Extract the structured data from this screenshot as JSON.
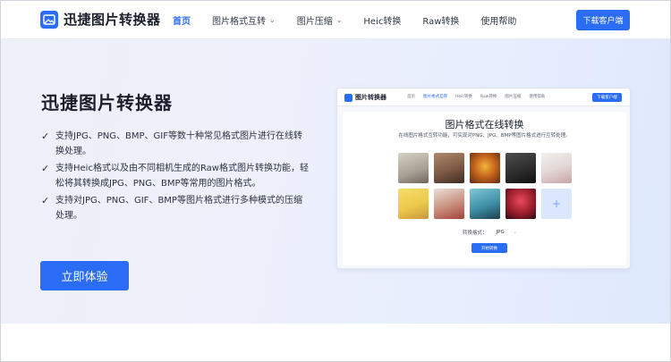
{
  "nav": {
    "logo_text": "迅捷图片转换器",
    "menu": [
      {
        "label": "首页",
        "has_dropdown": false,
        "active": true
      },
      {
        "label": "图片格式互转",
        "has_dropdown": true,
        "active": false
      },
      {
        "label": "图片压缩",
        "has_dropdown": true,
        "active": false
      },
      {
        "label": "Heic转换",
        "has_dropdown": false,
        "active": false
      },
      {
        "label": "Raw转换",
        "has_dropdown": false,
        "active": false
      },
      {
        "label": "使用帮助",
        "has_dropdown": false,
        "active": false
      }
    ],
    "download_btn": "下载客户端"
  },
  "hero": {
    "title": "迅捷图片转换器",
    "features": [
      "支持JPG、PNG、BMP、GIF等数十种常见格式图片进行在线转换处理。",
      "支持Heic格式以及由不同相机生成的Raw格式图片转换功能，轻松将其转换成JPG、PNG、BMP等常用的图片格式。",
      "支持对JPG、PNG、GIF、BMP等图片格式进行多种模式的压缩处理。"
    ],
    "cta_label": "立即体验"
  },
  "preview": {
    "logo_text": "图片转换器",
    "menu": [
      "首页",
      "图片格式互转",
      "Heic转换",
      "Raw转换",
      "图片压缩",
      "使用帮助"
    ],
    "download_btn": "下载客户端",
    "title": "图片格式在线转换",
    "subtitle": "在线图片格式互转功能，可实现对PNG、JPG、BMP等图片格式进行互转处理。",
    "format_label": "转换格式：",
    "format_value": "JPG",
    "start_btn": "开始转换"
  },
  "colors": {
    "accent": "#2a6df4",
    "text_dark": "#1a1f2b"
  }
}
